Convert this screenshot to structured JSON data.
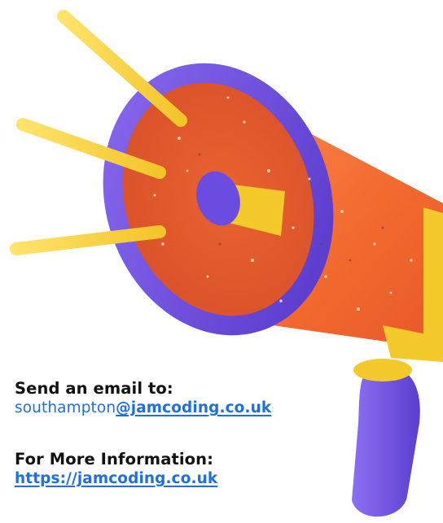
{
  "illustration": {
    "icon": "megaphone-icon",
    "colors": {
      "horn_orange": "#f26a2e",
      "rim_purple": "#6b4ce0",
      "ray_yellow": "#f5d437",
      "handle_purple": "#7450e2",
      "collar_yellow": "#f4c92b"
    }
  },
  "email": {
    "heading": "Send an email to:",
    "address_local": "southampton",
    "address_domain": "@jamcoding.co.uk"
  },
  "more_info": {
    "heading": "For More Information:",
    "url": "https://jamcoding.co.uk"
  },
  "colors": {
    "link": "#1f6fe0",
    "heading": "#111111"
  }
}
